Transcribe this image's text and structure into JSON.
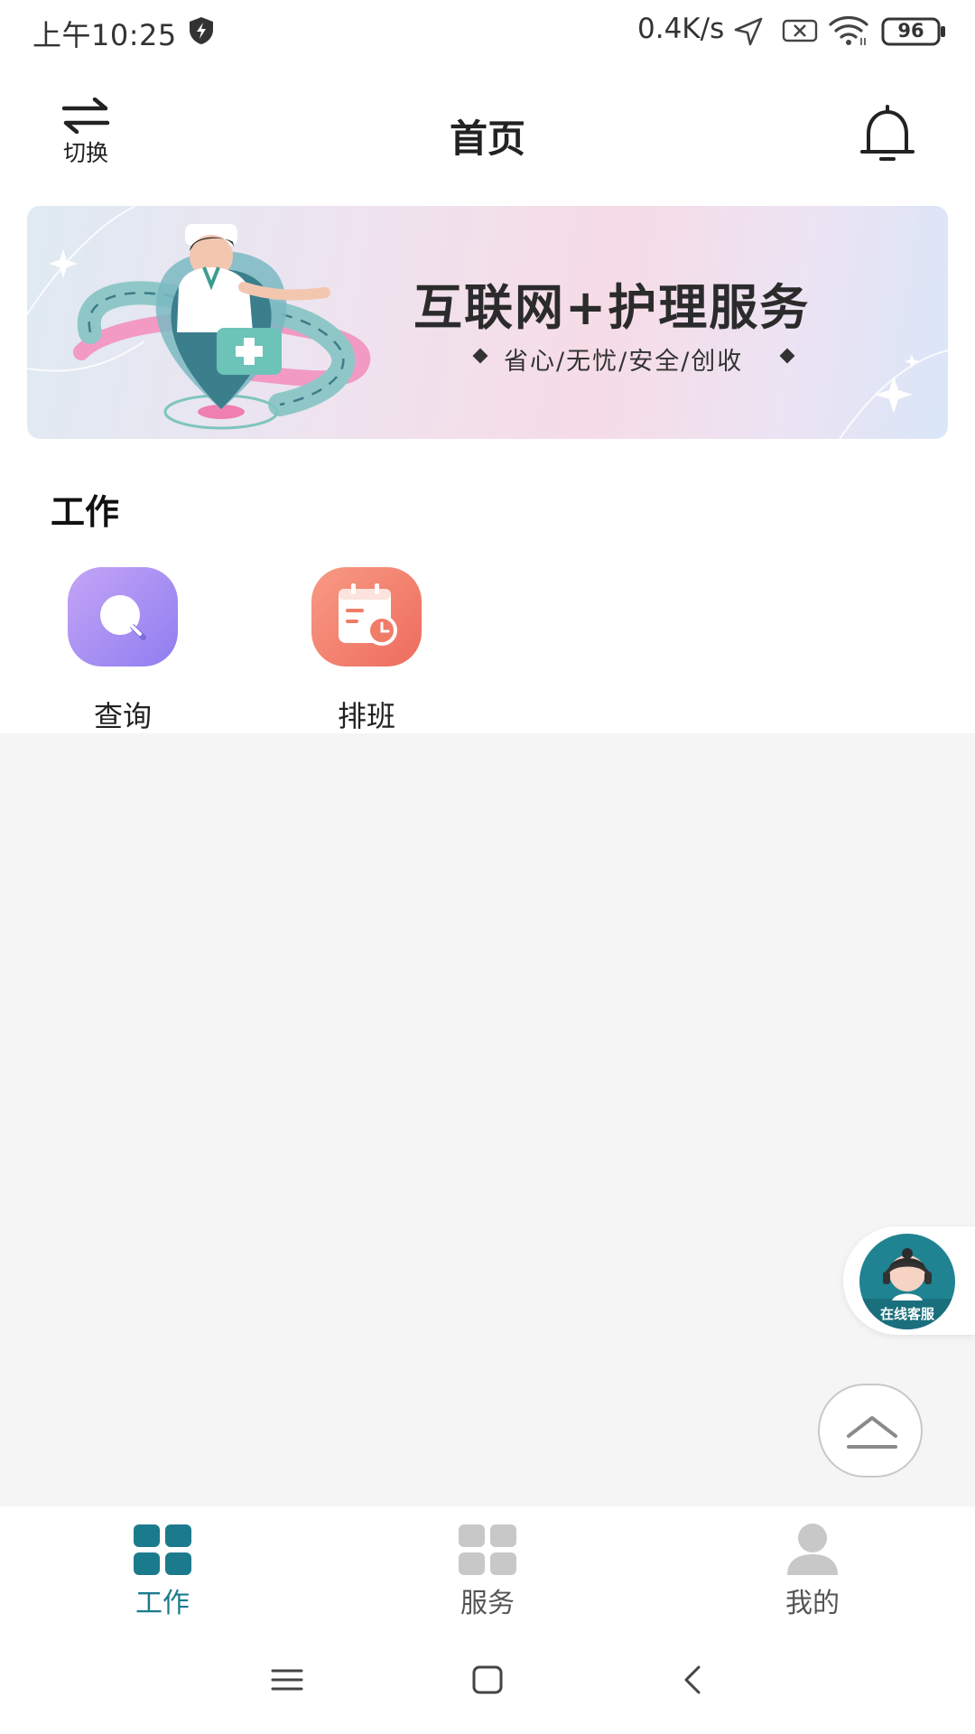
{
  "status_bar": {
    "time": "上午10:25",
    "net_speed": "0.4K/s",
    "battery": "96"
  },
  "header": {
    "switch_label": "切换",
    "title": "首页"
  },
  "banner": {
    "title": "互联网+护理服务",
    "subtitle": "省心/无忧/安全/创收"
  },
  "work": {
    "section_title": "工作",
    "items": [
      {
        "label": "查询",
        "icon": "search-icon"
      },
      {
        "label": "排班",
        "icon": "calendar-clock-icon"
      }
    ]
  },
  "customer_service": {
    "label": "在线客服"
  },
  "bottom_nav": {
    "items": [
      {
        "label": "工作",
        "icon": "grid-icon",
        "active": true
      },
      {
        "label": "服务",
        "icon": "grid-icon",
        "active": false
      },
      {
        "label": "我的",
        "icon": "user-icon",
        "active": false
      }
    ]
  },
  "colors": {
    "accent": "#1b7b8c",
    "inactive": "#c8c8c8",
    "inactive_text": "#555555",
    "page_bg": "#f5f5f5"
  }
}
